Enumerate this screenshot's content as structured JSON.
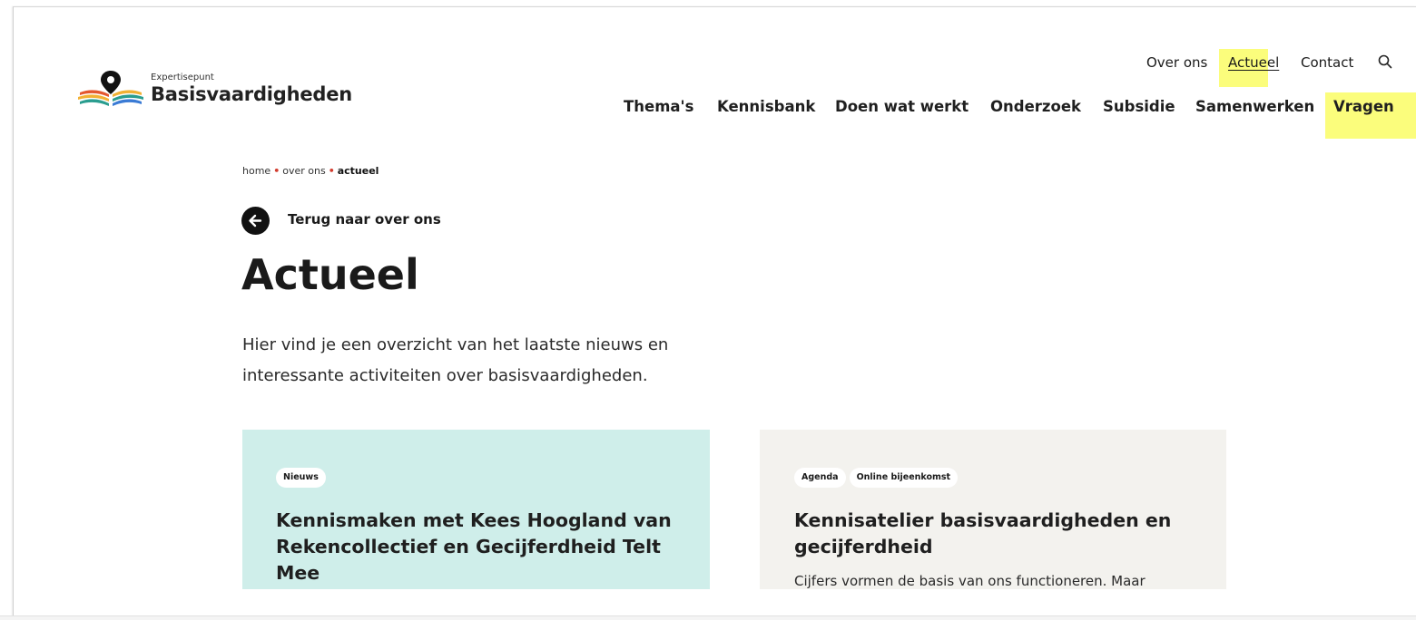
{
  "logo": {
    "subtitle": "Expertisepunt",
    "name": "Basisvaardigheden",
    "colors": [
      "#e4572e",
      "#f2b134",
      "#2a9d8f",
      "#3a7bd5"
    ]
  },
  "top_nav": {
    "items": [
      "Over ons",
      "Actueel",
      "Contact"
    ],
    "search_icon": "search-icon"
  },
  "main_nav": {
    "items": [
      "Thema's",
      "Kennisbank",
      "Doen wat werkt",
      "Onderzoek",
      "Subsidie",
      "Samenwerken",
      "Vragen"
    ]
  },
  "breadcrumb": {
    "items": [
      "home",
      "over ons",
      "actueel"
    ]
  },
  "back_link": {
    "label": "Terug naar over ons",
    "icon": "arrow-left-icon"
  },
  "page": {
    "title": "Actueel",
    "intro_line1": "Hier vind je een overzicht van het laatste nieuws en",
    "intro_line2": "interessante activiteiten over basisvaardigheden."
  },
  "cards": [
    {
      "tags": [
        "Nieuws"
      ],
      "title": "Kennismaken met Kees Hoogland van Rekencollectief en Gecijferdheid Telt Mee",
      "description": "",
      "bg": "#cfeeea"
    },
    {
      "tags": [
        "Agenda",
        "Online bijeenkomst"
      ],
      "title": "Kennisatelier basisvaardigheden en gecijferdheid",
      "description": "Cijfers vormen de basis van ons functioneren. Maar",
      "bg": "#f3f2ee"
    }
  ],
  "highlight_color": "#fbfd7c"
}
